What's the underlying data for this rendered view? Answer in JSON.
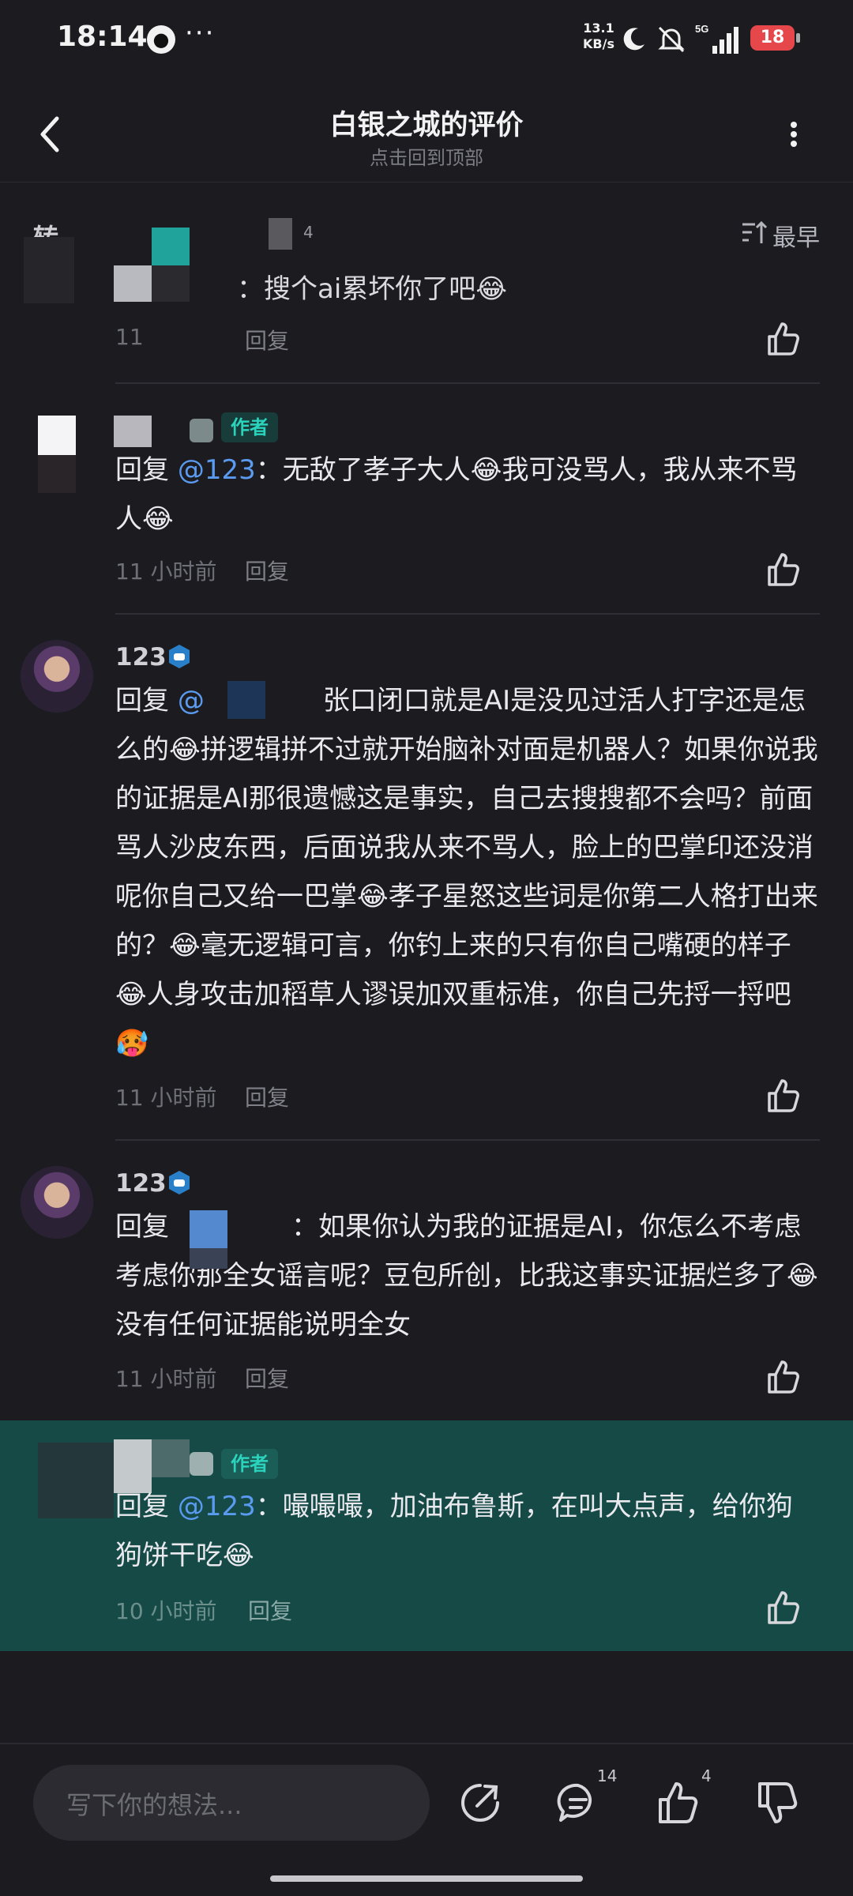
{
  "status_bar": {
    "time": "18:14",
    "qq_icon": "qq-icon",
    "dots": "···",
    "net_speed_value": "13.1",
    "net_speed_unit": "KB/s",
    "network": "5G",
    "battery": "18"
  },
  "header": {
    "title": "白银之城的评价",
    "subtitle": "点击回到顶部"
  },
  "filter": {
    "left_label": "转",
    "count": "4",
    "sort_label": "最早"
  },
  "comments": [
    {
      "text_visible": "：搜个ai累坏你了吧😂",
      "time": "11",
      "reply_label": "回复"
    },
    {
      "author_tag": "作者",
      "reply_word": "回复 ",
      "mention": "@123",
      "text": "：无敌了孝子大人😂我可没骂人，我从来不骂人😂",
      "time": "11 小时前",
      "reply_label": "回复"
    },
    {
      "username": "123",
      "reply_word": "回复 ",
      "mention": "@",
      "text": "张口闭口就是AI是没见过活人打字还是怎么的😂拼逻辑拼不过就开始脑补对面是机器人？如果你说我的证据是AI那很遗憾这是事实，自己去搜搜都不会吗？前面骂人沙皮东西，后面说我从来不骂人，脸上的巴掌印还没消呢你自己又给一巴掌😂孝子星怒这些词是你第二人格打出来的？😂毫无逻辑可言，你钓上来的只有你自己嘴硬的样子😂人身攻击加稻草人谬误加双重标准，你自己先捋一捋吧🥵",
      "time": "11 小时前",
      "reply_label": "回复"
    },
    {
      "username": "123",
      "reply_word": "回复",
      "text": "：如果你认为我的证据是AI，你怎么不考虑考虑你那全女谣言呢？豆包所创，比我这事实证据烂多了😂没有任何证据能说明全女",
      "time": "11 小时前",
      "reply_label": "回复"
    },
    {
      "author_tag": "作者",
      "reply_word": "回复 ",
      "mention": "@123",
      "text": "：嘬嘬嘬，加油布鲁斯，在叫大点声，给你狗狗饼干吃😂",
      "time": "10 小时前",
      "reply_label": "回复"
    }
  ],
  "bottom_bar": {
    "input_placeholder": "写下你的想法...",
    "comment_count": "14",
    "like_count": "4"
  },
  "colors": {
    "background": "#1c1c20",
    "highlight": "#154a47",
    "mention": "#5a9bf0",
    "author_tag": "#2bd3bd",
    "battery": "#e5474b"
  }
}
